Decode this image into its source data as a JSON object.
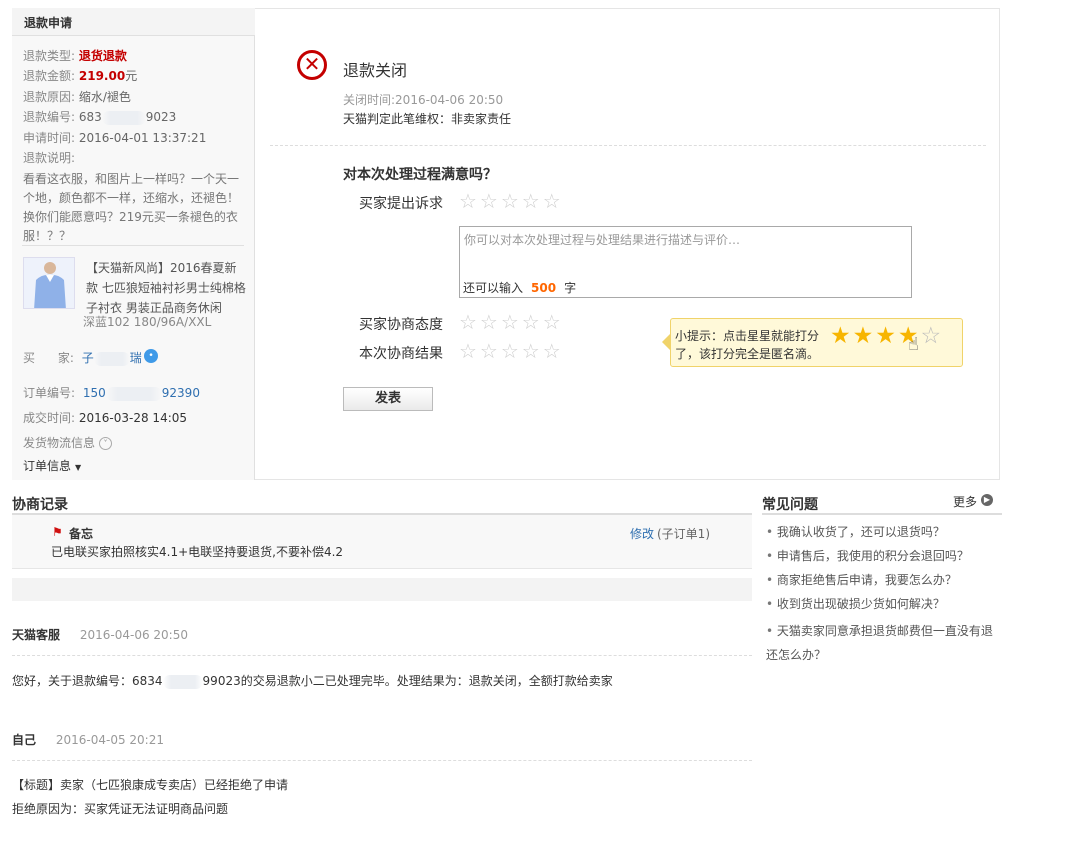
{
  "refund_panel": {
    "title": "退款申请",
    "type_label": "退款类型:",
    "type_value": "退货退款",
    "amount_label": "退款金额:",
    "amount_value": "219.00",
    "amount_unit": "元",
    "reason_label": "退款原因:",
    "reason_value": "缩水/褪色",
    "refund_no_label": "退款编号:",
    "refund_no_prefix": "683",
    "refund_no_suffix": "9023",
    "apply_time_label": "申请时间:",
    "apply_time_value": "2016-04-01 13:37:21",
    "desc_label": "退款说明:",
    "desc_value": "看看这衣服，和图片上一样吗？一个天一个地，颜色都不一样，还缩水，还褪色！换你们能愿意吗？219元买一条褪色的衣服！？？",
    "product_title": "【天猫新风尚】2016春夏新款 七匹狼短袖衬衫男士纯棉格子衬衣 男装正品商务休闲",
    "product_sku": "深蓝102    180/96A/XXL",
    "buyer_label": "买      家:",
    "buyer_prefix": "子",
    "buyer_suffix": "瑞",
    "order_no_label": "订单编号:",
    "order_no_prefix": "150",
    "order_no_suffix": "92390",
    "deal_time_label": "成交时间:",
    "deal_time_value": "2016-03-28 14:05",
    "logistics_label": "发货物流信息",
    "order_info_label": "订单信息"
  },
  "status": {
    "title": "退款关闭",
    "close_time": "关闭时间:2016-04-06 20:50",
    "judgement": "天猫判定此笔维权：非卖家责任"
  },
  "survey": {
    "question": "对本次处理过程满意吗？",
    "rating_labels": [
      "买家提出诉求",
      "买家协商态度",
      "本次协商结果"
    ],
    "star_glyphs": "☆☆☆☆☆",
    "comment_placeholder": "你可以对本次处理过程与处理结果进行描述与评价…",
    "char_count_prefix": "还可以输入",
    "char_count_value": "500",
    "char_count_suffix": "字",
    "tip_text": "小提示：点击星星就能打分了，该打分完全是匿名滴。",
    "tip_rating": 0.8,
    "publish_button": "发表"
  },
  "records": {
    "title": "协商记录",
    "memo_title": "备忘",
    "memo_edit": "修改",
    "memo_sub": "(子订单1)",
    "memo_text": "已电联买家拍照核实4.1+电联坚持要退货,不要补偿4.2",
    "messages": [
      {
        "author": "天猫客服",
        "time": "2016-04-06 20:50",
        "text_prefix": "您好，关于退款编号：6834",
        "text_suffix": "99023的交易退款小二已处理完毕。处理结果为：退款关闭，全额打款给卖家"
      },
      {
        "author": "自己",
        "time": "2016-04-05 20:21",
        "line1": "【标题】卖家（七匹狼康成专卖店）已经拒绝了申请",
        "line2": "拒绝原因为：买家凭证无法证明商品问题"
      }
    ]
  },
  "faq": {
    "title": "常见问题",
    "more": "更多",
    "items": [
      "我确认收货了，还可以退货吗？",
      "申请售后，我使用的积分会退回吗？",
      "商家拒绝售后申请，我要怎么办？",
      "收到货出现破损少货如何解决？",
      "天猫卖家同意承担退货邮费但一直没有退还怎么办？"
    ]
  }
}
